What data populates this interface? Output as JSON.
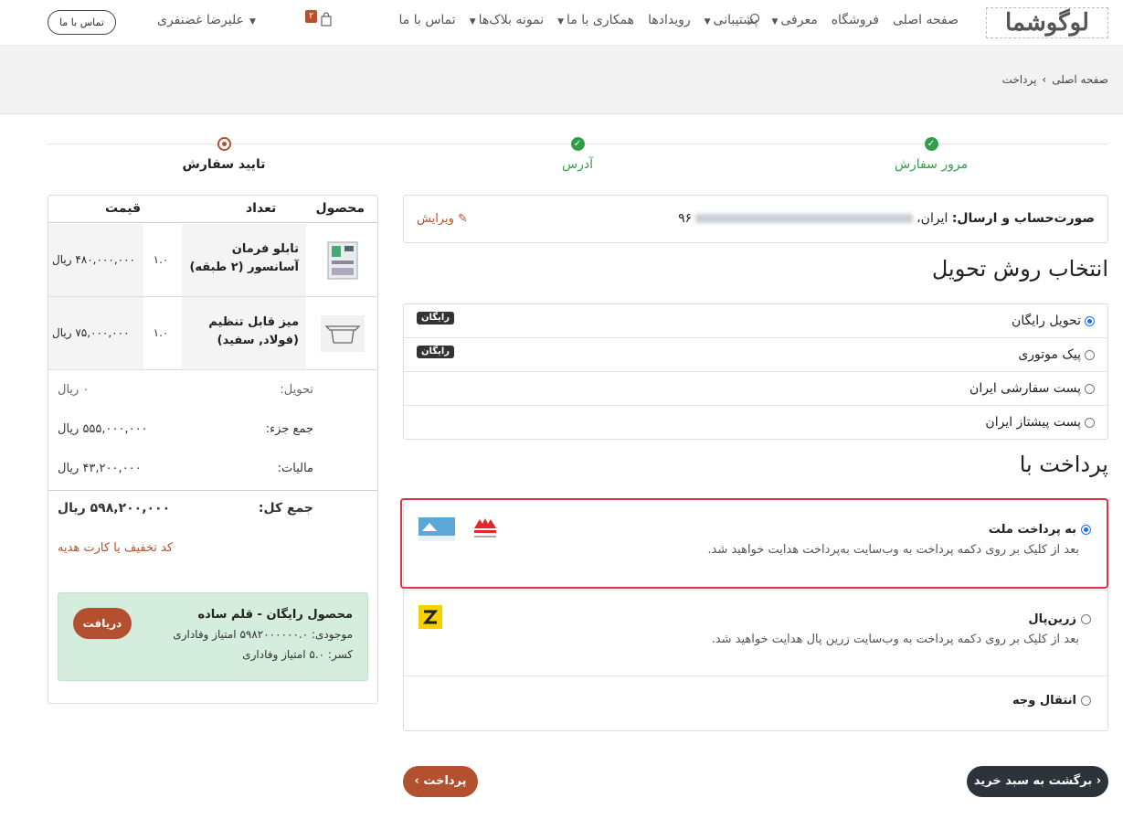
{
  "nav": {
    "logo": "لوگوشما",
    "menu": [
      {
        "label": "صفحه اصلی",
        "caret": false
      },
      {
        "label": "فروشگاه",
        "caret": false
      },
      {
        "label": "معرفی",
        "caret": true
      },
      {
        "label": "پشتیبانی",
        "caret": true
      },
      {
        "label": "رویدادها",
        "caret": false
      },
      {
        "label": "همکاری با ما",
        "caret": true
      },
      {
        "label": "نمونه بلاک‌ها",
        "caret": true
      },
      {
        "label": "تماس با ما",
        "caret": false
      }
    ],
    "cart_count": "۲",
    "user": "علیرضا غضنفری",
    "contact_button": "تماس با ما"
  },
  "breadcrumb": {
    "home": "صفحه اصلی",
    "current": "پرداخت"
  },
  "steps": [
    {
      "label": "مرور سفارش",
      "state": "done"
    },
    {
      "label": "آدرس",
      "state": "done"
    },
    {
      "label": "تایید سفارش",
      "state": "current"
    }
  ],
  "address": {
    "label": "صورت‌حساب و ارسال:",
    "country": "ایران،",
    "phone_tail": "۹۶",
    "edit": "ویرایش"
  },
  "delivery": {
    "title": "انتخاب روش تحویل",
    "options": [
      {
        "label": "تحویل رایگان",
        "badge": "رایگان",
        "selected": true
      },
      {
        "label": "پیک موتوری",
        "badge": "رایگان",
        "selected": false
      },
      {
        "label": "پست سفارشی ایران",
        "badge": "",
        "selected": false
      },
      {
        "label": "پست پیشتاز ایران",
        "badge": "",
        "selected": false
      }
    ]
  },
  "payment": {
    "title": "پرداخت با",
    "options": [
      {
        "label": "به پرداخت ملت",
        "desc": "بعد از کلیک بر روی دکمه پرداخت به وب‌سایت به‌پرداخت هدایت خواهید شد.",
        "selected": true
      },
      {
        "label": "زرین‌پال",
        "desc": "بعد از کلیک بر روی دکمه پرداخت به وب‌سایت زرین پال هدایت خواهید شد.",
        "selected": false
      },
      {
        "label": "انتقال وجه",
        "desc": "",
        "selected": false
      }
    ]
  },
  "buttons": {
    "back": "برگشت به سبد خرید",
    "pay": "پرداخت"
  },
  "order": {
    "headers": {
      "product": "محصول",
      "qty": "تعداد",
      "price": "قیمت"
    },
    "items": [
      {
        "name": "تابلو فرمان آسانسور (۲ طبقه)",
        "qty": "۱.۰",
        "price": "۴۸۰,۰۰۰,۰۰۰ ریال"
      },
      {
        "name": "میز قابل تنظیم (فولاد, سفید)",
        "qty": "۱.۰",
        "price": "۷۵,۰۰۰,۰۰۰ ریال"
      }
    ],
    "delivery_label": "تحویل:",
    "delivery_value": "۰ ریال",
    "subtotal_label": "جمع جزء:",
    "subtotal_value": "۵۵۵,۰۰۰,۰۰۰ ریال",
    "tax_label": "مالیات:",
    "tax_value": "۴۳,۲۰۰,۰۰۰ ریال",
    "total_label": "جمع کل:",
    "total_value": "۵۹۸,۲۰۰,۰۰۰ ریال",
    "coupon": "کد تخفیف یا کارت هدیه",
    "reward": {
      "title": "محصول رایگان - قلم ساده",
      "balance": "موجودی: ۵۹۸۲۰۰۰۰۰۰.۰ امتیاز وفاداری",
      "cost": "کسر: ۵.۰ امتیاز وفاداری",
      "button": "دریافت"
    }
  }
}
